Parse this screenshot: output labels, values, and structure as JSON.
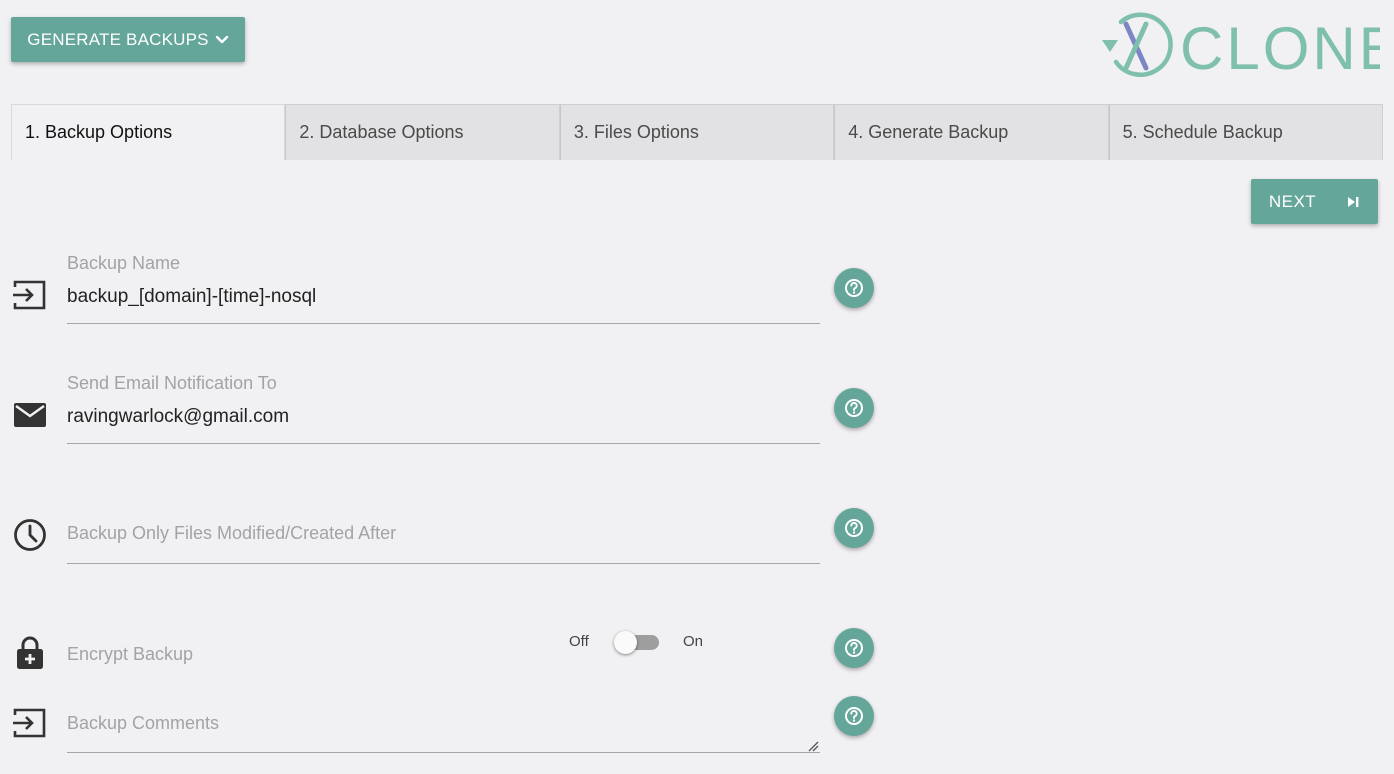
{
  "toolbar": {
    "generate_label": "GENERATE BACKUPS",
    "next_label": "NEXT"
  },
  "logo": {
    "text": "CLONER",
    "mark": "X"
  },
  "tabs": [
    {
      "label": "1. Backup Options",
      "active": true
    },
    {
      "label": "2. Database Options",
      "active": false
    },
    {
      "label": "3. Files Options",
      "active": false
    },
    {
      "label": "4. Generate Backup",
      "active": false
    },
    {
      "label": "5. Schedule Backup",
      "active": false
    }
  ],
  "form": {
    "backup_name": {
      "label": "Backup Name",
      "value": "backup_[domain]-[time]-nosql",
      "icon": "input-icon"
    },
    "email": {
      "label": "Send Email Notification To",
      "value": "ravingwarlock@gmail.com",
      "icon": "mail-icon"
    },
    "modified_after": {
      "label": "Backup Only Files Modified/Created After",
      "value": "",
      "icon": "clock-icon"
    },
    "encrypt": {
      "label": "Encrypt Backup",
      "off_label": "Off",
      "on_label": "On",
      "state": "off",
      "icon": "lock-plus-icon"
    },
    "comments": {
      "label": "Backup Comments",
      "value": "",
      "icon": "input-icon"
    }
  },
  "colors": {
    "accent": "#64a69a",
    "background": "#f1f0f2",
    "tab_inactive": "#e2e1e3",
    "logo_green": "#7fbfae",
    "logo_x": "#7c86c4"
  }
}
